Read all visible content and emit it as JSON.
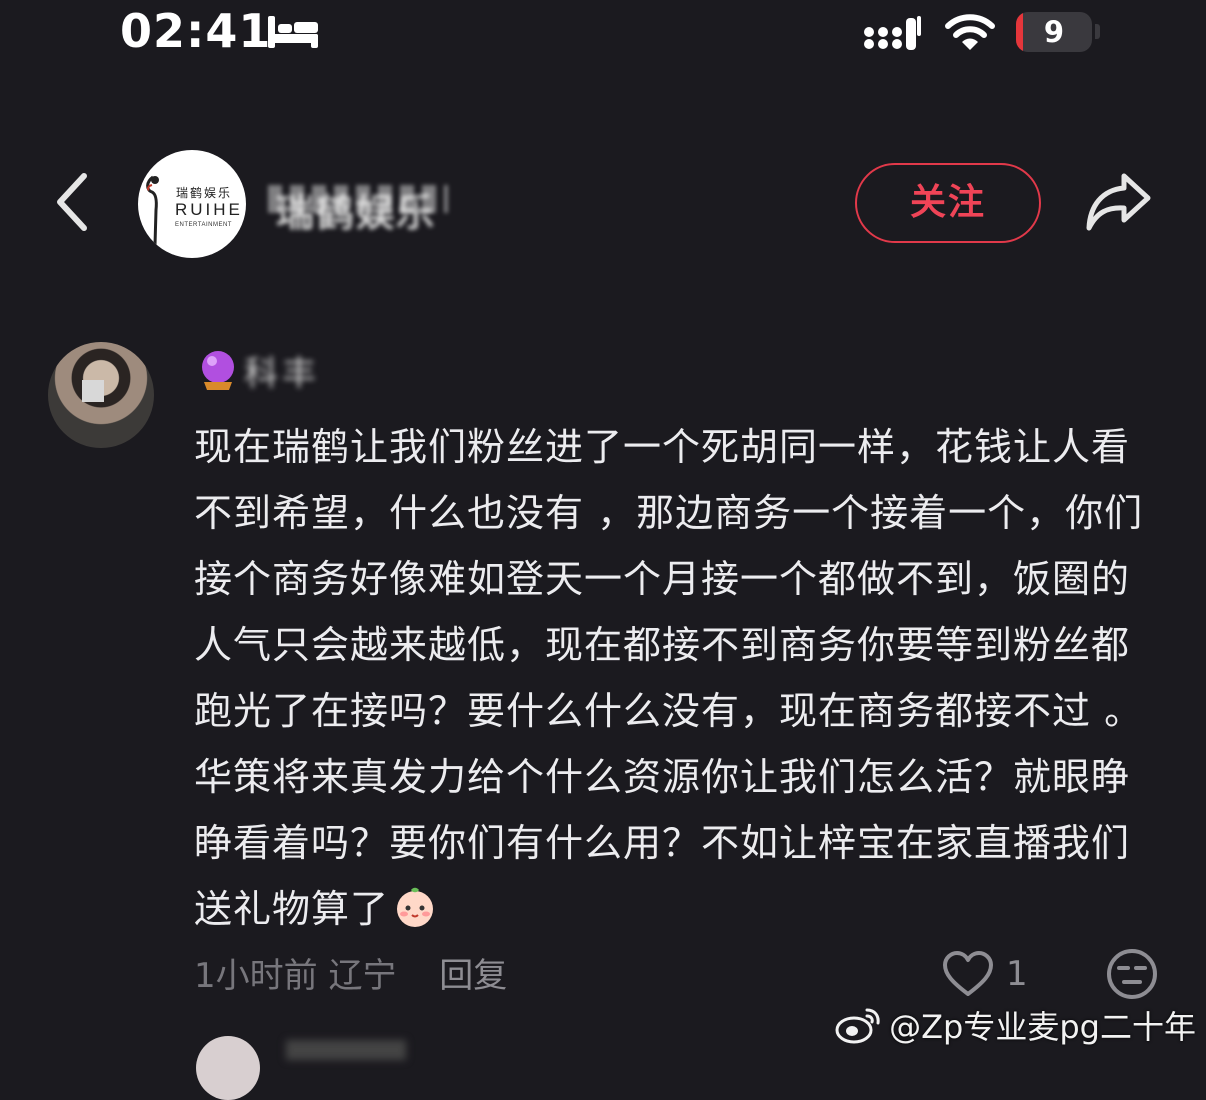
{
  "status_bar": {
    "time": "02:41",
    "battery_level": "9",
    "battery_fraction": 0.09,
    "icons": [
      "bed-icon",
      "cellular-signal-icon",
      "wifi-icon",
      "battery-icon"
    ]
  },
  "header": {
    "back_icon": "chevron-left-icon",
    "account_logo": {
      "cn": "瑞鹤娱乐",
      "en": "RUIHE",
      "sub": "ENTERTAINMENT"
    },
    "account_name": "瑞鹤娱乐",
    "follow_label": "关注",
    "share_icon": "share-arrow-icon",
    "follow_color": "#f04457"
  },
  "comment": {
    "author": "科丰 ",
    "text": "现在瑞鹤让我们粉丝进了一个死胡同一样，花钱让人看不到希望，什么也没有 ，那边商务一个接着一个，你们接个商务好像难如登天一个月接一个都做不到，饭圈的人气只会越来越低，现在都接不到商务你要等到粉丝都跑光了在接吗？要什么什么没有，现在商务都接不过 。华策将来真发力给个什么资源你让我们怎么活？就眼睁睁看着吗？要你们有什么用？不如让梓宝在家直播我们送礼物算了",
    "time": "1小时前",
    "location": "辽宁",
    "reply_label": "回复",
    "like_count": "1"
  },
  "watermark": "@Zp专业麦pg二十年"
}
